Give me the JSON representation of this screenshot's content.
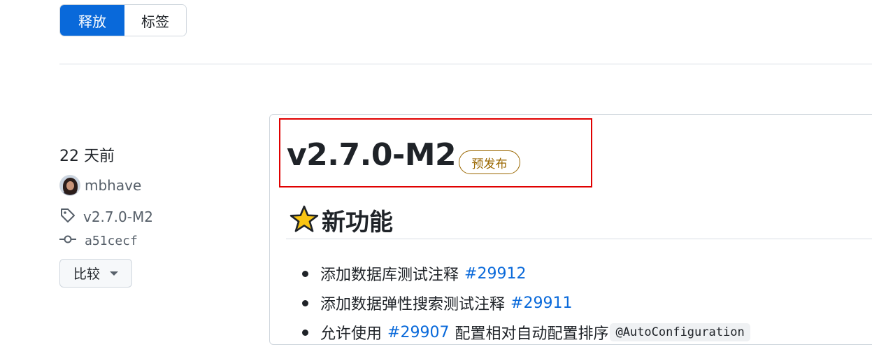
{
  "view_toggle": {
    "releases_label": "释放",
    "tags_label": "标签"
  },
  "release_meta": {
    "time": "22 天前",
    "author": "mbhave",
    "tag": "v2.7.0-M2",
    "commit": "a51cecf",
    "compare_label": "比较"
  },
  "release": {
    "title": "v2.7.0-M2",
    "badge": "预发布",
    "section_heading": "新功能",
    "items": [
      {
        "text": "添加数据库测试注释",
        "link": "#29912"
      },
      {
        "text": "添加数据弹性搜索测试注释",
        "link": "#29911"
      },
      {
        "text": "允许使用",
        "link": "#29907",
        "after": "配置相对自动配置排序",
        "code": "@AutoConfiguration"
      }
    ]
  },
  "colors": {
    "accent": "#0969da",
    "prerelease": "#9a6700",
    "highlight_box": "#e00000"
  },
  "icons": [
    "tag-icon",
    "git-commit-icon",
    "star-icon",
    "caret-down-icon"
  ]
}
